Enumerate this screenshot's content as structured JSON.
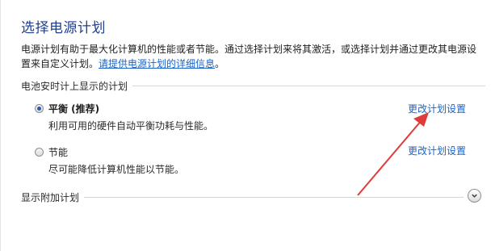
{
  "page": {
    "title": "选择电源计划",
    "description_text": "电源计划有助于最大化计算机的性能或者节能。通过选择计划来将其激活，或选择计划并通过更改其电源设置来自定义计划。",
    "description_link": "请提供电源计划的详细信息",
    "description_tail": "。"
  },
  "battery_section": {
    "heading": "电池安时计上显示的计划",
    "plans": [
      {
        "name": "平衡 (推荐)",
        "desc": "利用可用的硬件自动平衡功耗与性能。",
        "selected": true,
        "change_label": "更改计划设置"
      },
      {
        "name": "节能",
        "desc": "尽可能降低计算机性能以节能。",
        "selected": false,
        "change_label": "更改计划设置"
      }
    ]
  },
  "additional_section": {
    "heading": "显示附加计划"
  },
  "icons": {
    "expand": "chevron-down-icon"
  },
  "colors": {
    "title": "#1f3f8f",
    "link": "#1a63c8",
    "annotation_arrow": "#e03b3b"
  }
}
